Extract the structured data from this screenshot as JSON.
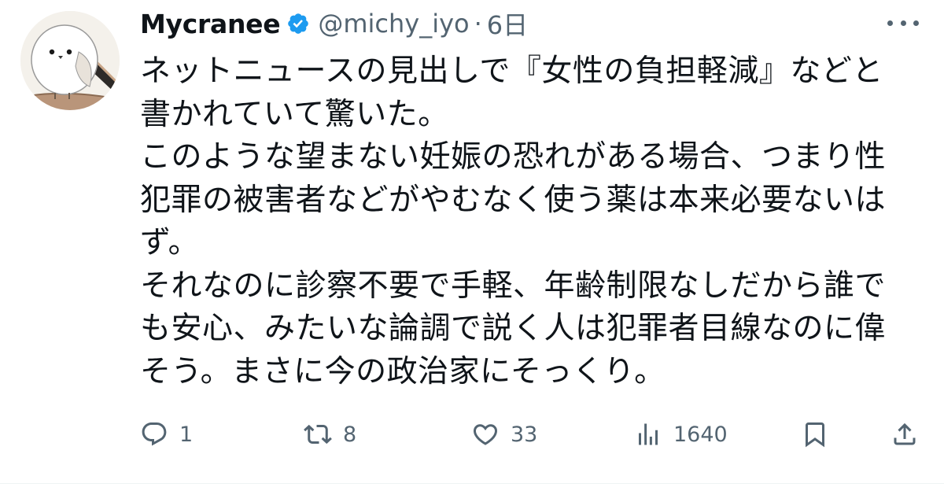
{
  "author": {
    "display_name": "Mycranee",
    "handle": "@michy_iyo",
    "separator": "·",
    "timestamp": "6日"
  },
  "tweet": {
    "lines": [
      "ネットニュースの見出しで『女性の負担軽減』などと",
      "書かれていて驚いた。",
      "このような望まない妊娠の恐れがある場合、つまり性",
      "犯罪の被害者などがやむなく使う薬は本来必要ないは",
      "ず。",
      "それなのに診察不要で手軽、年齢制限なしだから誰で",
      "も安心、みたいな論調で説く人は犯罪者目線なのに偉",
      "そう。まさに今の政治家にそっくり。"
    ]
  },
  "actions": {
    "reply_count": "1",
    "retweet_count": "8",
    "like_count": "33",
    "views_count": "1640"
  },
  "icons": {
    "verified": "verified-badge-icon",
    "reply": "reply-icon",
    "retweet": "retweet-icon",
    "like": "heart-icon",
    "views": "views-icon",
    "bookmark": "bookmark-icon",
    "share": "share-icon",
    "more": "more-icon"
  },
  "colors": {
    "verified_blue": "#1d9bf0",
    "text_primary": "#0f1419",
    "text_secondary": "#536471"
  }
}
